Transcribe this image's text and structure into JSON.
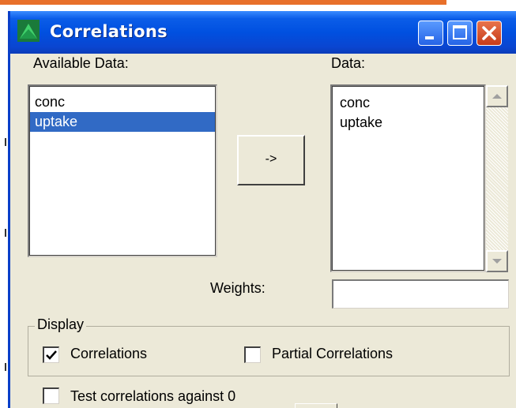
{
  "window": {
    "title": "Correlations"
  },
  "available_data": {
    "label": "Available Data:",
    "items": [
      {
        "text": "conc",
        "selected": false
      },
      {
        "text": "uptake",
        "selected": true
      }
    ]
  },
  "transfer_button": {
    "label": "->"
  },
  "data": {
    "label": "Data:",
    "items": [
      "conc",
      "uptake"
    ]
  },
  "weights": {
    "label": "Weights:",
    "value": ""
  },
  "display": {
    "legend": "Display",
    "correlations": {
      "label": "Correlations",
      "checked": true
    },
    "partial_correlations": {
      "label": "Partial Correlations",
      "checked": false
    }
  },
  "test_correlations": {
    "label": "Test correlations against 0",
    "checked": false
  },
  "colors": {
    "titlebar": "#0054e3",
    "selection": "#316ac5",
    "dialog_bg": "#ece9d8",
    "close_button": "#c63b1a"
  },
  "icons": {
    "app": "chart-icon",
    "minimize": "minimize-icon",
    "maximize": "maximize-icon",
    "close": "close-icon"
  }
}
